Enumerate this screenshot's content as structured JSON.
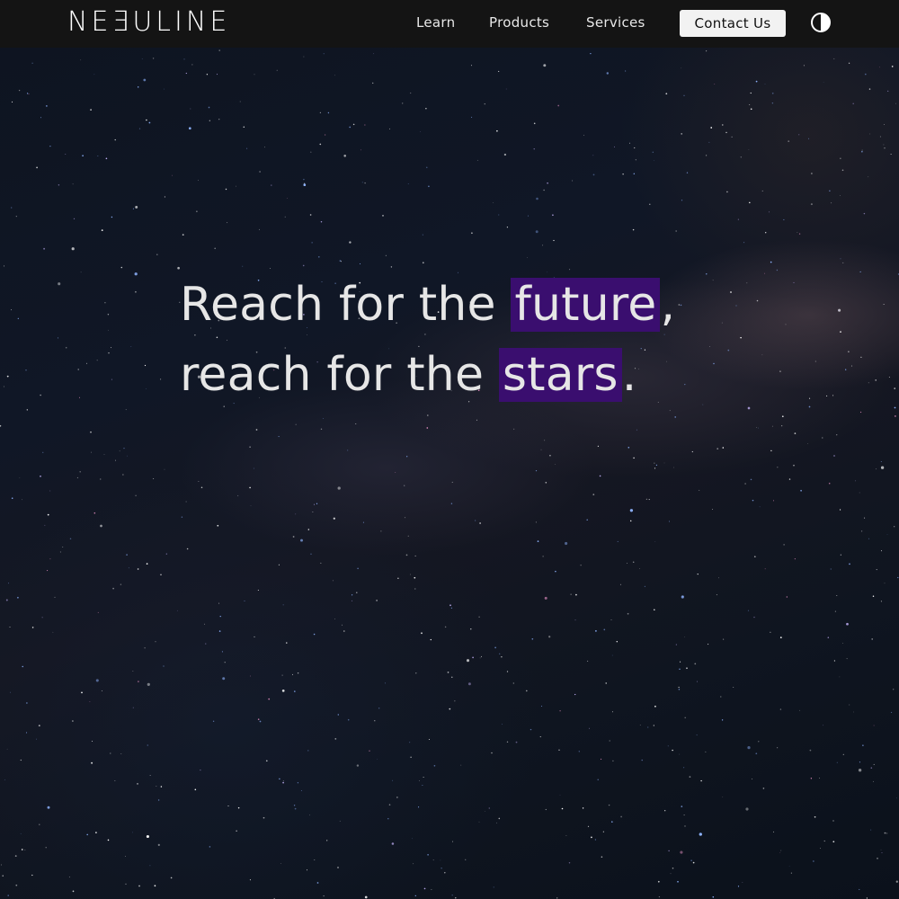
{
  "brand": {
    "logo_text": "NEƎULINE"
  },
  "nav": {
    "links": [
      {
        "label": "Learn"
      },
      {
        "label": "Products"
      },
      {
        "label": "Services"
      }
    ],
    "contact_label": "Contact Us",
    "theme_toggle_icon": "contrast-icon"
  },
  "hero": {
    "line1_prefix": "Reach for the ",
    "line1_highlight": "future",
    "line1_suffix": ",",
    "line2_prefix": "reach for the ",
    "line2_highlight": "stars",
    "line2_suffix": "."
  },
  "colors": {
    "navbar_bg": "#141414",
    "highlight": "#3a0e6f",
    "hero_text": "#e6e6e6",
    "button_bg": "#f2f2f2"
  }
}
